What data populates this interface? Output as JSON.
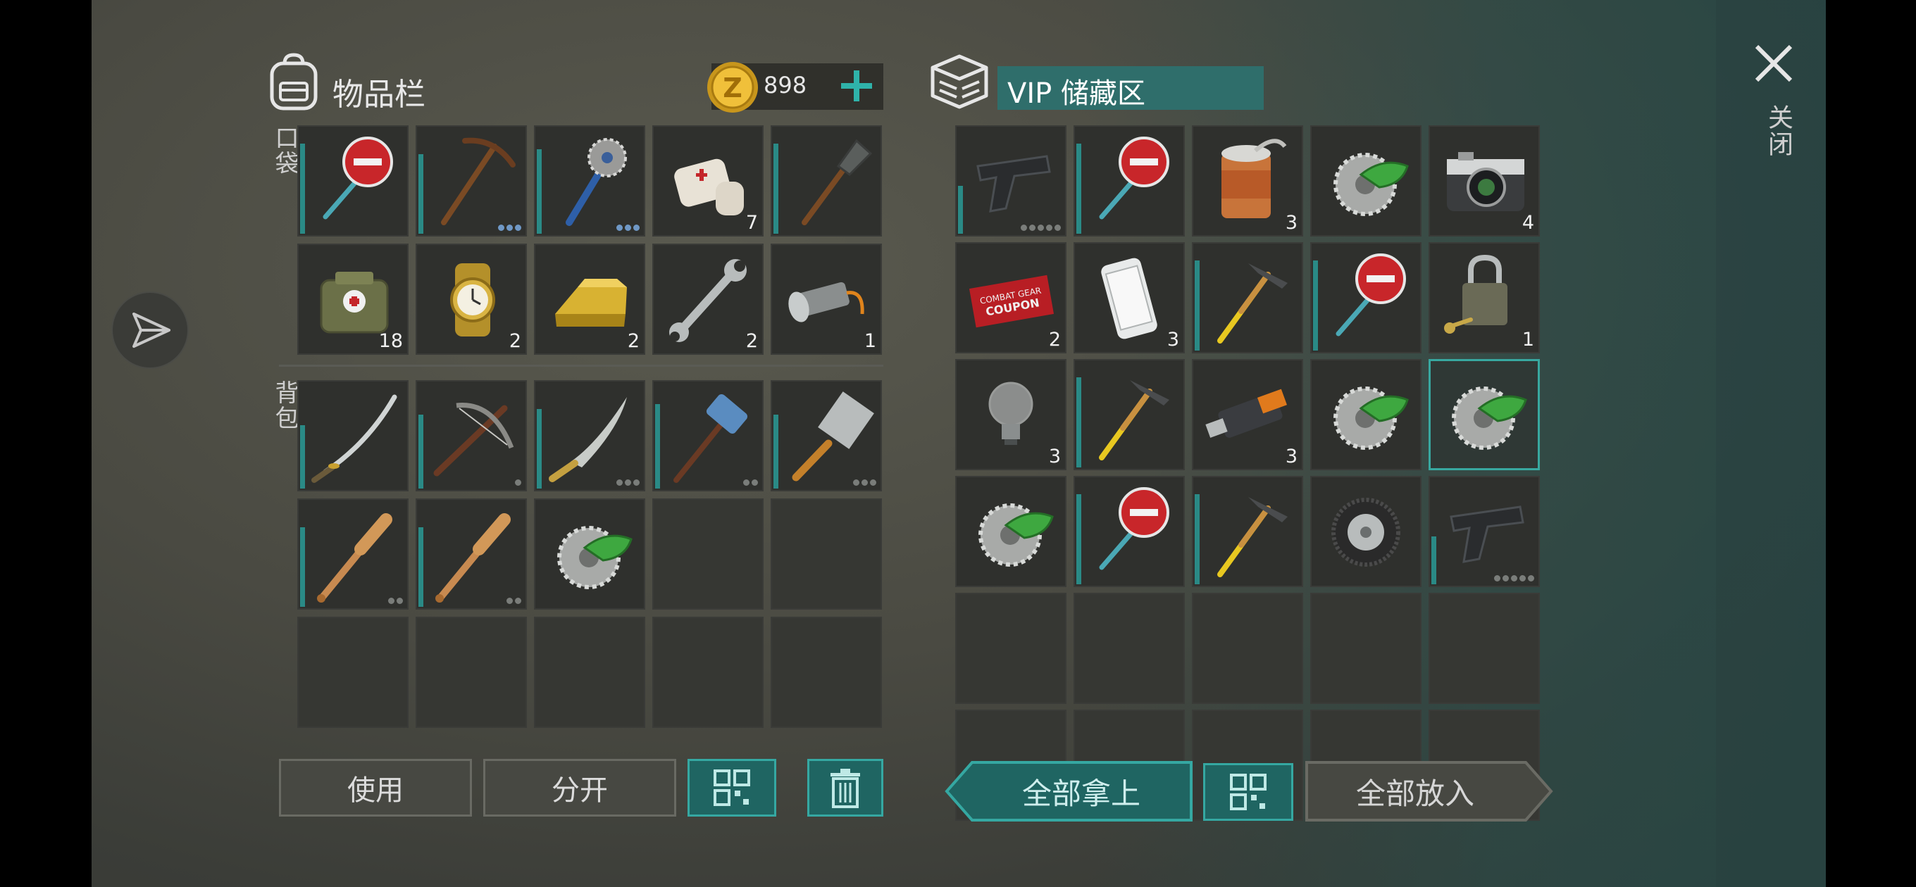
{
  "inventory": {
    "title": "物品栏",
    "currency_amount": "898",
    "pocket_label": "口袋",
    "backpack_label": "背包",
    "pocket": [
      {
        "icon": "stop-sign-icon",
        "cond": 0.85
      },
      {
        "icon": "pickaxe-icon",
        "cond": 0.75,
        "dots": 3,
        "dots_color": "blue"
      },
      {
        "icon": "saw-mace-icon",
        "cond": 0.8,
        "dots": 3,
        "dots_color": "blue"
      },
      {
        "icon": "bandage-icon",
        "qty": "7"
      },
      {
        "icon": "shovel-icon",
        "cond": 0.85
      },
      {
        "icon": "medkit-icon",
        "qty": "18"
      },
      {
        "icon": "watch-icon",
        "qty": "2"
      },
      {
        "icon": "gold-bar-icon",
        "qty": "2"
      },
      {
        "icon": "wrench-icon",
        "qty": "2"
      },
      {
        "icon": "flashlight-icon",
        "qty": "1"
      }
    ],
    "backpack": [
      {
        "icon": "katana-icon",
        "cond": 0.6
      },
      {
        "icon": "crossbow-icon",
        "cond": 0.7,
        "dots": 1
      },
      {
        "icon": "machete-icon",
        "cond": 0.75,
        "dots": 3
      },
      {
        "icon": "sledgehammer-icon",
        "cond": 0.8,
        "dots": 2
      },
      {
        "icon": "cleaver-icon",
        "cond": 0.7,
        "dots": 3
      },
      {
        "icon": "baseball-bat-icon",
        "cond": 0.75,
        "dots": 2
      },
      {
        "icon": "baseball-bat-icon",
        "cond": 0.75,
        "dots": 2
      },
      {
        "icon": "saw-blade-icon"
      },
      {
        "icon": ""
      },
      {
        "icon": ""
      },
      {
        "icon": ""
      },
      {
        "icon": ""
      },
      {
        "icon": ""
      },
      {
        "icon": ""
      },
      {
        "icon": ""
      }
    ],
    "buttons": {
      "use": "使用",
      "split": "分开"
    }
  },
  "vip": {
    "title": "VIP 储藏区",
    "slots": [
      {
        "icon": "pistol-icon",
        "cond": 0.45,
        "dots": 5
      },
      {
        "icon": "stop-sign-icon",
        "cond": 0.85
      },
      {
        "icon": "tin-can-icon",
        "qty": "3"
      },
      {
        "icon": "saw-blade-icon"
      },
      {
        "icon": "camera-icon",
        "qty": "4"
      },
      {
        "icon": "coupon-icon",
        "qty": "2"
      },
      {
        "icon": "smartphone-icon",
        "qty": "3"
      },
      {
        "icon": "hammer-icon",
        "cond": 0.85
      },
      {
        "icon": "stop-sign-icon",
        "cond": 0.85
      },
      {
        "icon": "padlock-icon",
        "qty": "1"
      },
      {
        "icon": "light-bulb-icon",
        "qty": "3"
      },
      {
        "icon": "hammer-icon",
        "cond": 0.85
      },
      {
        "icon": "usb-drive-icon",
        "qty": "3"
      },
      {
        "icon": "saw-blade-icon"
      },
      {
        "icon": "saw-blade-icon",
        "selected": true
      },
      {
        "icon": "saw-blade-icon"
      },
      {
        "icon": "stop-sign-icon",
        "cond": 0.85
      },
      {
        "icon": "hammer-icon",
        "cond": 0.85
      },
      {
        "icon": "tire-icon"
      },
      {
        "icon": "pistol-icon",
        "cond": 0.45,
        "dots": 5
      },
      {
        "icon": ""
      },
      {
        "icon": ""
      },
      {
        "icon": ""
      },
      {
        "icon": ""
      },
      {
        "icon": ""
      },
      {
        "icon": ""
      },
      {
        "icon": ""
      },
      {
        "icon": ""
      },
      {
        "icon": ""
      },
      {
        "icon": ""
      }
    ],
    "buttons": {
      "take_all": "全部拿上",
      "put_all": "全部放入"
    }
  },
  "close_label": "关闭",
  "colors": {
    "accent": "#35a8a2",
    "condition": "#2a8a86"
  }
}
